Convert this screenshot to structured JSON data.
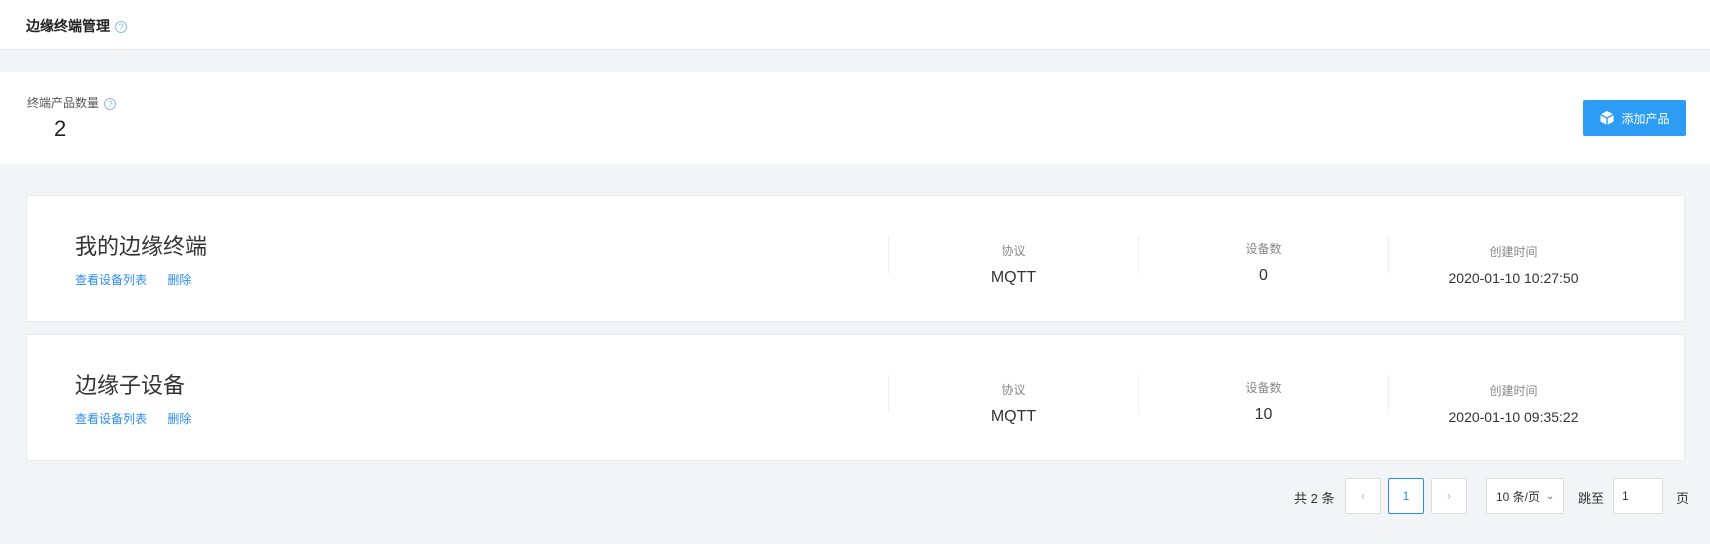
{
  "header": {
    "title": "边缘终端管理",
    "help_icon": "?"
  },
  "summary": {
    "label": "终端产品数量",
    "help_icon": "?",
    "count": "2",
    "add_button_label": "添加产品",
    "add_button_icon": "cube-icon"
  },
  "products": [
    {
      "name": "我的边缘终端",
      "view_devices_label": "查看设备列表",
      "delete_label": "删除",
      "protocol_label": "协议",
      "protocol": "MQTT",
      "device_count_label": "设备数",
      "device_count": "0",
      "created_label": "创建时间",
      "created": "2020-01-10 10:27:50"
    },
    {
      "name": "边缘子设备",
      "view_devices_label": "查看设备列表",
      "delete_label": "删除",
      "protocol_label": "协议",
      "protocol": "MQTT",
      "device_count_label": "设备数",
      "device_count": "10",
      "created_label": "创建时间",
      "created": "2020-01-10 09:35:22"
    }
  ],
  "pagination": {
    "total_text": "共 2 条",
    "prev_icon": "‹",
    "current_page": "1",
    "next_icon": "›",
    "page_size": "10 条/页",
    "jump_label": "跳至",
    "jump_value": "1",
    "jump_suffix": "页"
  },
  "colors": {
    "accent": "#2d9cf5",
    "link": "#2d8cf0",
    "background": "#f3f4f6"
  }
}
